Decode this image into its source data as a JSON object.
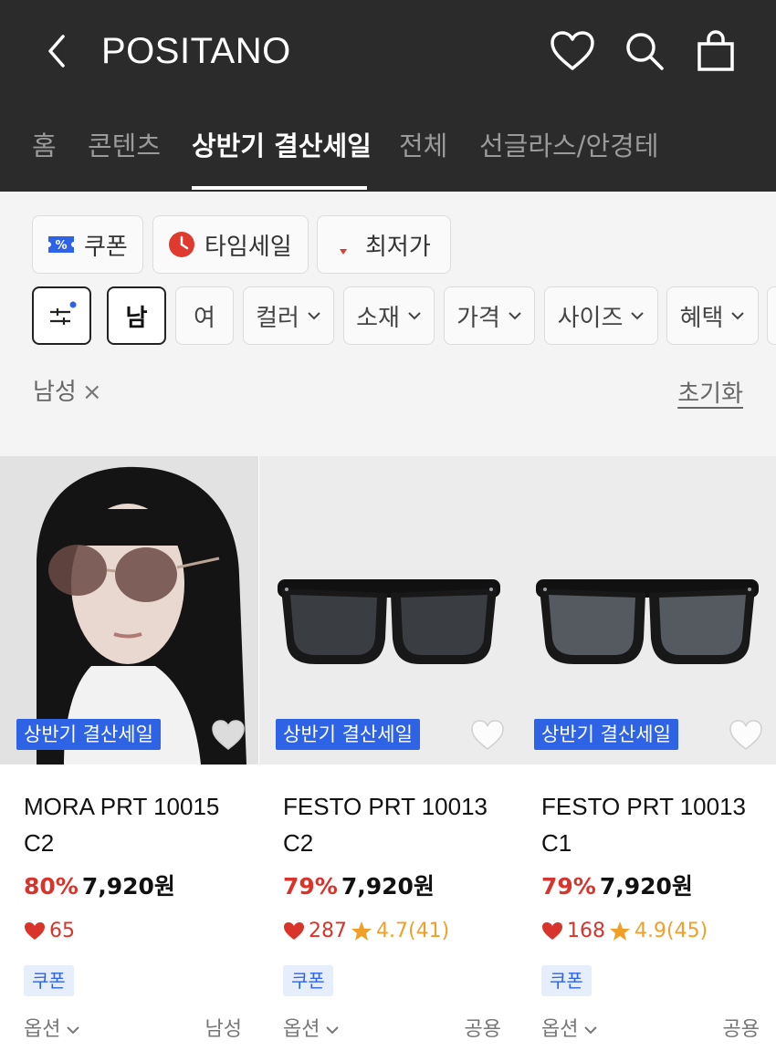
{
  "header": {
    "brand": "POSITANO",
    "tabs": [
      "홈",
      "콘텐츠",
      "상반기 결산세일",
      "전체",
      "선글라스/안경테"
    ],
    "active_tab": "상반기 결산세일"
  },
  "quick_filters": [
    {
      "label": "쿠폰",
      "icon": "coupon-icon"
    },
    {
      "label": "타임세일",
      "icon": "clock-icon"
    },
    {
      "label": "최저가",
      "icon": "down-arrow-icon"
    }
  ],
  "filters": {
    "male": "남",
    "female": "여",
    "color": "컬러",
    "material": "소재",
    "price": "가격",
    "size": "사이즈",
    "benefit": "혜택"
  },
  "applied_filter": "남성",
  "applied_remove": "×",
  "reset_label": "초기화",
  "products": [
    {
      "badge": "상반기 결산세일",
      "name": "MORA PRT 10015 C2",
      "discount": "80%",
      "price": "7,920원",
      "likes": "65",
      "rating": "",
      "coupon": "쿠폰",
      "option_label": "옵션",
      "gender": "남성"
    },
    {
      "badge": "상반기 결산세일",
      "name": "FESTO PRT 10013 C2",
      "discount": "79%",
      "price": "7,920원",
      "likes": "287",
      "rating": "4.7(41)",
      "coupon": "쿠폰",
      "option_label": "옵션",
      "gender": "공용"
    },
    {
      "badge": "상반기 결산세일",
      "name": "FESTO PRT 10013 C1",
      "discount": "79%",
      "price": "7,920원",
      "likes": "168",
      "rating": "4.9(45)",
      "coupon": "쿠폰",
      "option_label": "옵션",
      "gender": "공용"
    }
  ],
  "colors": {
    "header_bg": "#2b2b2b",
    "accent_blue": "#2f63e6",
    "sale_red": "#d9342b",
    "star_orange": "#f0a028"
  }
}
